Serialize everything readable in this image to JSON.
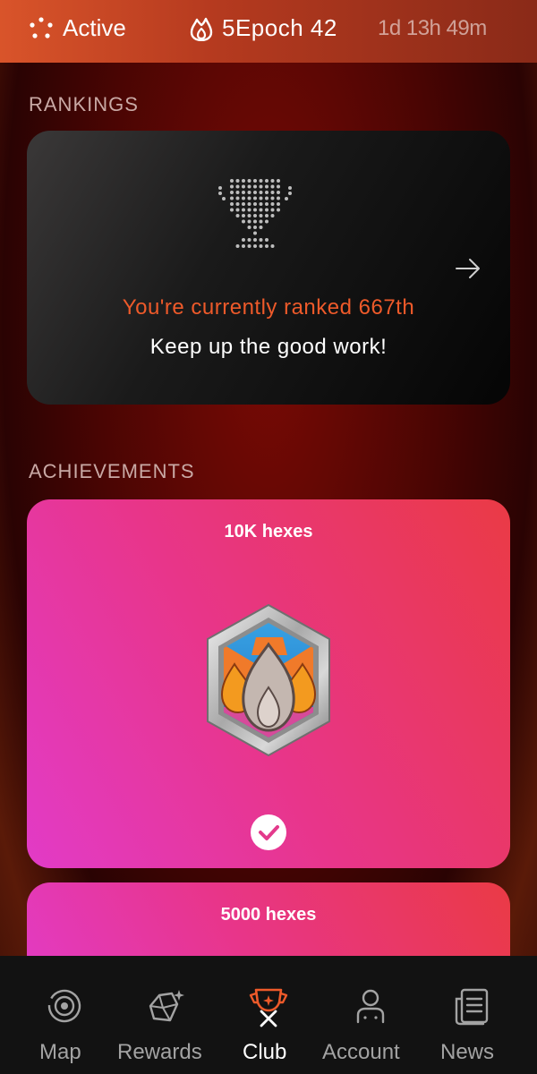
{
  "header": {
    "status_label": "Active",
    "epoch_label": "5Epoch 42",
    "timer": "1d 13h 49m"
  },
  "rankings": {
    "section_title": "RANKINGS",
    "rank_text": "You're currently ranked 667th",
    "encouragement": "Keep up the good work!"
  },
  "achievements": {
    "section_title": "ACHIEVEMENTS",
    "items": [
      {
        "title": "10K hexes",
        "completed": true
      },
      {
        "title": "5000 hexes"
      }
    ]
  },
  "nav": {
    "items": [
      {
        "label": "Map",
        "icon": "map-target-icon"
      },
      {
        "label": "Rewards",
        "icon": "rewards-gem-icon"
      },
      {
        "label": "Club",
        "icon": "club-trophy-icon",
        "active": true
      },
      {
        "label": "Account",
        "icon": "account-person-icon"
      },
      {
        "label": "News",
        "icon": "news-document-icon"
      }
    ]
  },
  "colors": {
    "accent": "#ee5a2a",
    "nav_active": "#ee5a2a",
    "nav_inactive": "#a3a3a3"
  }
}
